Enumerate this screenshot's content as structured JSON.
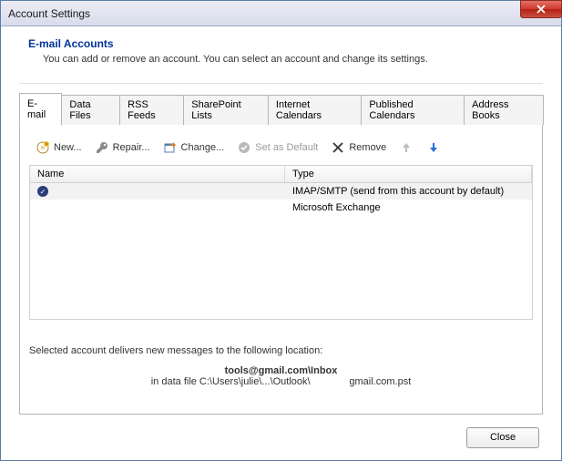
{
  "window": {
    "title": "Account Settings"
  },
  "header": {
    "title": "E-mail Accounts",
    "desc": "You can add or remove an account. You can select an account and change its settings."
  },
  "tabs": [
    {
      "label": "E-mail",
      "active": true
    },
    {
      "label": "Data Files"
    },
    {
      "label": "RSS Feeds"
    },
    {
      "label": "SharePoint Lists"
    },
    {
      "label": "Internet Calendars"
    },
    {
      "label": "Published Calendars"
    },
    {
      "label": "Address Books"
    }
  ],
  "toolbar": {
    "new": "New...",
    "repair": "Repair...",
    "change": "Change...",
    "default": "Set as Default",
    "remove": "Remove"
  },
  "grid": {
    "columns": {
      "name": "Name",
      "type": "Type"
    },
    "rows": [
      {
        "name": "",
        "type": "IMAP/SMTP (send from this account by default)",
        "default": true,
        "selected": true
      },
      {
        "name": "",
        "type": "Microsoft Exchange",
        "default": false
      }
    ]
  },
  "delivery": {
    "intro": "Selected account delivers new messages to the following location:",
    "line1": "tools@gmail.com\\Inbox",
    "line2_a": "in data file C:\\Users\\julie\\...\\Outlook\\",
    "line2_b": "gmail.com.pst"
  },
  "footer": {
    "close": "Close"
  }
}
